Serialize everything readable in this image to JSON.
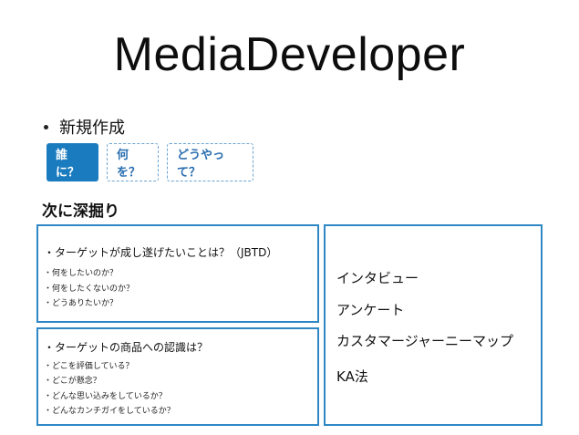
{
  "title": "MediaDeveloper",
  "bullet": "新規作成",
  "tabs": [
    {
      "label": "誰に？"
    },
    {
      "label": "何を？"
    },
    {
      "label": "どうやって？"
    }
  ],
  "section_heading": "次に深掘り",
  "box1": {
    "title": "・ターゲットが成し遂げたいことは？（JBTD）",
    "items": [
      "・何をしたいのか？",
      "・何をしたくないのか？",
      "・どうありたいか？"
    ]
  },
  "box2": {
    "title": "・ターゲットの商品への認識は？",
    "items": [
      "・どこを評価している？",
      "・どこが懸念？",
      "・どんな思い込みをしているか？",
      "・どんなカンチガイをしているか？"
    ]
  },
  "methods": [
    "インタビュー",
    "アンケート",
    "カスタマージャーニーマップ",
    "KA法"
  ],
  "colors": {
    "accent": "#1a7bbf",
    "border": "#2f88c5"
  }
}
